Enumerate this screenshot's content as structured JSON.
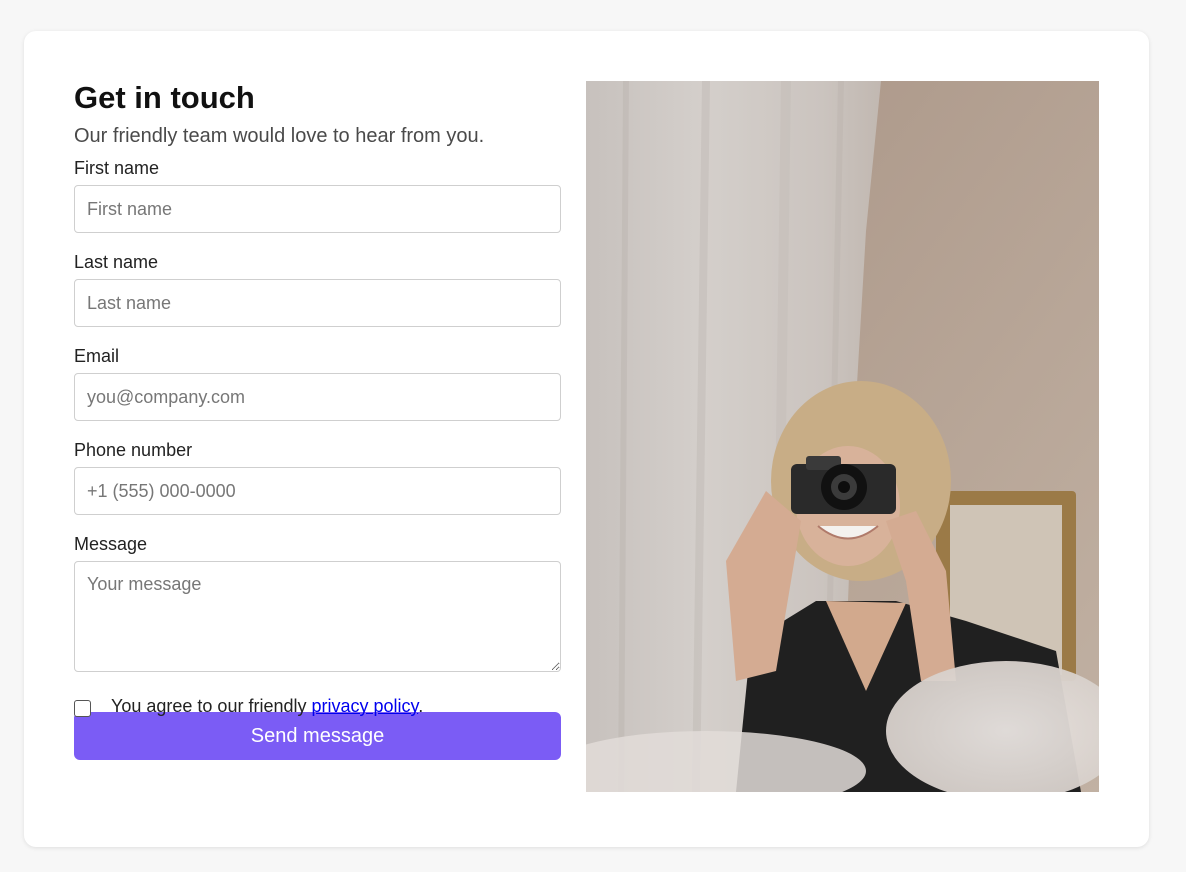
{
  "form": {
    "title": "Get in touch",
    "subtitle": "Our friendly team would love to hear from you.",
    "fields": {
      "first_name": {
        "label": "First name",
        "placeholder": "First name"
      },
      "last_name": {
        "label": "Last name",
        "placeholder": "Last name"
      },
      "email": {
        "label": "Email",
        "placeholder": "you@company.com"
      },
      "phone": {
        "label": "Phone number",
        "placeholder": "+1 (555) 000-0000"
      },
      "message": {
        "label": "Message",
        "placeholder": "Your message"
      }
    },
    "agree": {
      "text_before": "You agree to our friendly ",
      "link_text": "privacy policy",
      "text_after": ".",
      "checked": false
    },
    "submit_label": "Send message"
  },
  "colors": {
    "accent": "#7b5cf5",
    "link": "#0000ee",
    "background": "#f7f7f7",
    "card": "#ffffff"
  }
}
